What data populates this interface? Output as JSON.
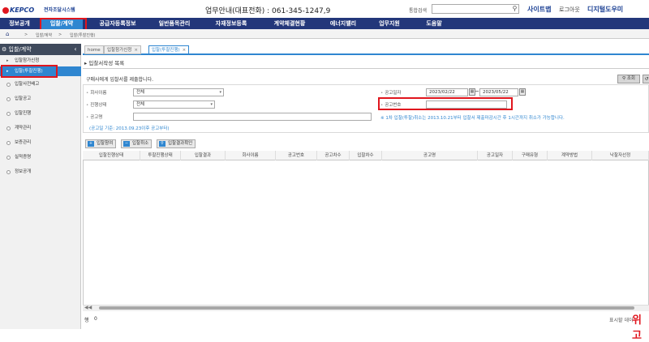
{
  "header": {
    "logo_text": "KEPCO",
    "system_name": "전자조달시스템",
    "helpdesk": "업무안내(대표전화) : 061-345-1247,9",
    "search_label": "통합검색",
    "search_value": "",
    "links": [
      "사이트맵",
      "로그아웃",
      "디지털도우미"
    ]
  },
  "main_nav": [
    "정보공개",
    "입찰/계약",
    "공급자등록정보",
    "일반품목관리",
    "자재정보등록",
    "계약체결현황",
    "에너지밸리",
    "업무지원",
    "도움말"
  ],
  "breadcrumb": [
    "입찰/계약",
    "입찰(투찰진행)"
  ],
  "sidebar": {
    "title": "입찰/계약",
    "items": [
      "입찰참가신청",
      "입찰(투찰진행)",
      "입찰사전배고",
      "입찰공고",
      "입찰진행",
      "계약관리",
      "보증관리",
      "실적증명",
      "정보공개"
    ]
  },
  "tabs": [
    "home",
    "입찰참가신청",
    "입찰(투찰진행)"
  ],
  "page": {
    "title": "입찰서작성 목록",
    "instruction": "구매사에게 입찰서를 제출합니다.",
    "search_button": "조회",
    "reset_button": "↺"
  },
  "form": {
    "company_label": "회사이름",
    "company_value": "전체",
    "progress_label": "진행상태",
    "progress_value": "전체",
    "notice_name_label": "공고명",
    "notice_name_value": "",
    "date_label": "공고일자",
    "date_from": "2023/02/22",
    "date_to": "2023/05/22",
    "notice_no_label": "공고번호",
    "notice_no_value": "",
    "notice_info": "※ 1차 입찰(투찰)취소는 2013.10.21부터 입찰서 제출마감시간 후 1시간까지 취소가 가능합니다.",
    "notice_basis": "(공고일 기준: 2013.09.23이후 공고부터)"
  },
  "actions": [
    "입찰참여",
    "입찰취소",
    "입찰결과확인"
  ],
  "grid": {
    "columns": [
      "입찰진행상태",
      "투찰진행상태",
      "입찰결과",
      "회사이름",
      "공고번호",
      "공고차수",
      "입찰차수",
      "공고명",
      "공고일자",
      "구매유형",
      "계약방법",
      "낙찰자선정"
    ],
    "rows": []
  },
  "footer": {
    "row_count_label": "행",
    "row_count": "0",
    "display_label": "표시할 데이",
    "watermark": "위고"
  },
  "colors": {
    "nav_bg": "#23377a",
    "active": "#2f86d0",
    "highlight": "#e0161e"
  }
}
